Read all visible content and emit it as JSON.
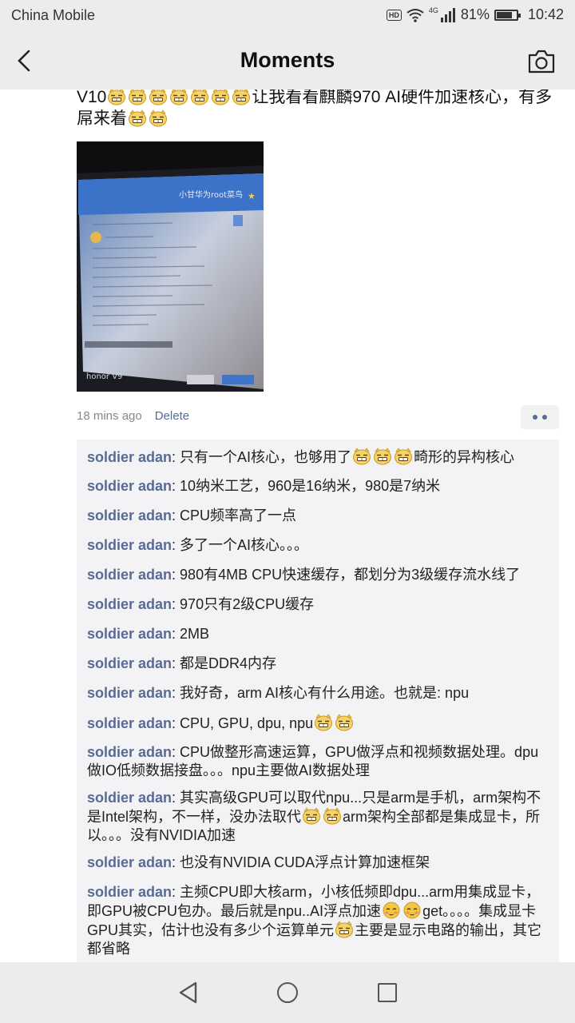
{
  "status_bar": {
    "carrier": "China Mobile",
    "hd": "HD",
    "network": "4G",
    "battery": "81%",
    "battery_level": 0.81,
    "time": "10:42"
  },
  "header": {
    "title": "Moments"
  },
  "post": {
    "text_prefix": "V10",
    "text_mid": "让我看看麒麟970 AI硬件加速核心，有多屌来着",
    "image_overlay": "小甘华为root菜鸟",
    "image_brand": "honor V9",
    "time": "18 mins ago",
    "delete_label": "Delete"
  },
  "comments": [
    {
      "author": "soldier adan",
      "before": "只有一个AI核心，也够用了",
      "emojis": 3,
      "after": "畸形的异构核心"
    },
    {
      "author": "soldier adan",
      "before": "10纳米工艺，960是16纳米，980是7纳米"
    },
    {
      "author": "soldier adan",
      "before": "CPU频率高了一点"
    },
    {
      "author": "soldier adan",
      "before": "多了一个AI核心。。。"
    },
    {
      "author": "soldier adan",
      "before": "980有4MB CPU快速缓存，都划分为3级缓存流水线了"
    },
    {
      "author": "soldier adan",
      "before": "970只有2级CPU缓存"
    },
    {
      "author": "soldier adan",
      "before": "2MB"
    },
    {
      "author": "soldier adan",
      "before": "都是DDR4内存"
    },
    {
      "author": "soldier adan",
      "before": "我好奇，arm AI核心有什么用途。也就是: npu"
    },
    {
      "author": "soldier adan",
      "before": "CPU, GPU, dpu, npu",
      "emojis": 2
    },
    {
      "author": "soldier adan",
      "before": "CPU做整形高速运算，GPU做浮点和视频数据处理。dpu做IO低频数据接盘。。。npu主要做AI数据处理"
    },
    {
      "author": "soldier adan",
      "before": "其实高级GPU可以取代npu...只是arm是手机，arm架构不是Intel架构，不一样，没办法取代",
      "emojis": 2,
      "after": "arm架构全部都是集成显卡，所以。。。没有NVIDIA加速"
    },
    {
      "author": "soldier adan",
      "before": "也没有NVIDIA CUDA浮点计算加速框架"
    },
    {
      "author": "soldier adan",
      "before": "主频CPU即大核arm，小核低频即dpu...arm用集成显卡，即GPU被CPU包办。最后就是npu..AI浮点加速",
      "emojis": 2,
      "emoji_kind": "blush",
      "after": "get。。。。集成显卡GPU其实，估计也没有多少个运算单元",
      "emojis2": 1,
      "after2": "主要是显示电路的输出，其它都省略"
    }
  ],
  "colors": {
    "link": "#576b95",
    "bar_bg": "#ececec",
    "comment_bg": "#f3f3f5"
  }
}
